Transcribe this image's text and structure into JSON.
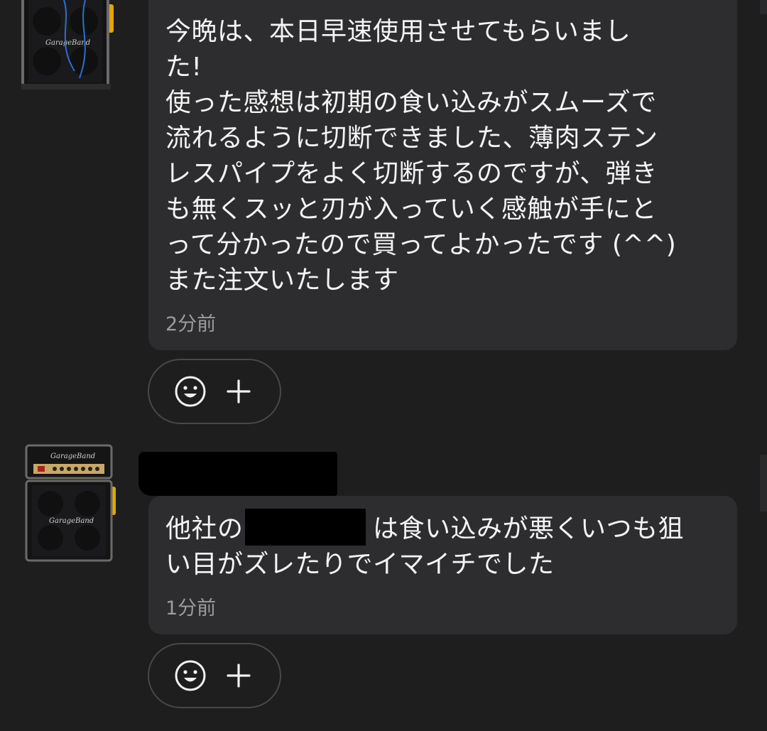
{
  "messages": [
    {
      "text": "今晩は、本日早速使用させてもらいまし\nた!\n使った感想は初期の食い込みがスムーズで\n流れるように切断できました、薄肉ステン\nレスパイプをよく切断するのですが、弾き\nも無くスッと刃が入っていく感触が手にと\nって分かったので買ってよかったです (^^)\nまた注文いたします",
      "time": "2分前",
      "avatar_brand": "GarageBand"
    },
    {
      "text": "他社の　　　　　は食い込みが悪くいつも狙\nい目がズレたりでイマイチでした",
      "time": "1分前",
      "avatar_brand": "GarageBand"
    }
  ],
  "icons": {
    "reaction": "smiley-face-icon",
    "add": "plus-icon"
  },
  "colors": {
    "background": "#1e1e1f",
    "bubble": "#2d2d2f",
    "text": "#f4f4f4",
    "timestamp": "#9c9c9e",
    "reaction_border": "#48484b",
    "avatar_accent": "#e0a800"
  }
}
